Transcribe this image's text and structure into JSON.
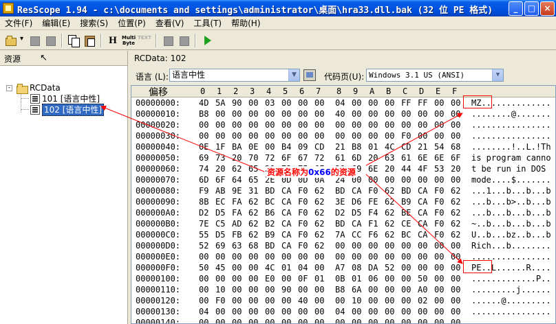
{
  "window": {
    "title": "ResScope 1.94 - c:\\documents and settings\\administrator\\桌面\\hra33.dll.bak (32 位 PE 格式)",
    "buttons": {
      "minimize": "_",
      "maximize": "□",
      "close": "×"
    }
  },
  "menu": [
    "文件(F)",
    "编辑(E)",
    "搜索(S)",
    "位置(P)",
    "查看(V)",
    "工具(T)",
    "帮助(H)"
  ],
  "toolbar": {
    "h_label": "H",
    "multibyte_label": "Multi Byte",
    "text_label": "TEXT"
  },
  "left_pane": {
    "header": "资源",
    "tree": {
      "root": "RCData",
      "expander": "-",
      "items": [
        "101 [语言中性]",
        "102 [语言中性]"
      ],
      "selected_index": 1
    }
  },
  "right_pane": {
    "rcdata_label": "RCData: 102",
    "language_label": "语言 (L):",
    "language_value": "语言中性",
    "codepage_label": "代码页(U):",
    "codepage_value": "Windows 3.1 US (ANSI)"
  },
  "hex_view": {
    "offset_header": "偏移",
    "columns": [
      "0",
      "1",
      "2",
      "3",
      "4",
      "5",
      "6",
      "7",
      "8",
      "9",
      "A",
      "B",
      "C",
      "D",
      "E",
      "F"
    ],
    "rows": [
      {
        "offset": "00000000:",
        "bytes": [
          "4D",
          "5A",
          "90",
          "00",
          "03",
          "00",
          "00",
          "00",
          "04",
          "00",
          "00",
          "00",
          "FF",
          "FF",
          "00",
          "00"
        ],
        "ascii": "MZ.............."
      },
      {
        "offset": "00000010:",
        "bytes": [
          "B8",
          "00",
          "00",
          "00",
          "00",
          "00",
          "00",
          "00",
          "40",
          "00",
          "00",
          "00",
          "00",
          "00",
          "00",
          "00"
        ],
        "ascii": "........@......."
      },
      {
        "offset": "00000020:",
        "bytes": [
          "00",
          "00",
          "00",
          "00",
          "00",
          "00",
          "00",
          "00",
          "00",
          "00",
          "00",
          "00",
          "00",
          "00",
          "00",
          "00"
        ],
        "ascii": "................"
      },
      {
        "offset": "00000030:",
        "bytes": [
          "00",
          "00",
          "00",
          "00",
          "00",
          "00",
          "00",
          "00",
          "00",
          "00",
          "00",
          "00",
          "F0",
          "00",
          "00",
          "00"
        ],
        "ascii": "................"
      },
      {
        "offset": "00000040:",
        "bytes": [
          "0E",
          "1F",
          "BA",
          "0E",
          "00",
          "B4",
          "09",
          "CD",
          "21",
          "B8",
          "01",
          "4C",
          "CD",
          "21",
          "54",
          "68"
        ],
        "ascii": "........!..L.!Th"
      },
      {
        "offset": "00000050:",
        "bytes": [
          "69",
          "73",
          "20",
          "70",
          "72",
          "6F",
          "67",
          "72",
          "61",
          "6D",
          "20",
          "63",
          "61",
          "6E",
          "6E",
          "6F"
        ],
        "ascii": "is program canno"
      },
      {
        "offset": "00000060:",
        "bytes": [
          "74",
          "20",
          "62",
          "65",
          "20",
          "72",
          "75",
          "6E",
          "20",
          "69",
          "6E",
          "20",
          "44",
          "4F",
          "53",
          "20"
        ],
        "ascii": "t be run in DOS "
      },
      {
        "offset": "00000070:",
        "bytes": [
          "6D",
          "6F",
          "64",
          "65",
          "2E",
          "0D",
          "0D",
          "0A",
          "24",
          "00",
          "00",
          "00",
          "00",
          "00",
          "00",
          "00"
        ],
        "ascii": "mode....$......."
      },
      {
        "offset": "00000080:",
        "bytes": [
          "F9",
          "AB",
          "9E",
          "31",
          "BD",
          "CA",
          "F0",
          "62",
          "BD",
          "CA",
          "F0",
          "62",
          "BD",
          "CA",
          "F0",
          "62"
        ],
        "ascii": "...1...b...b...b"
      },
      {
        "offset": "00000090:",
        "bytes": [
          "8B",
          "EC",
          "FA",
          "62",
          "BC",
          "CA",
          "F0",
          "62",
          "3E",
          "D6",
          "FE",
          "62",
          "B9",
          "CA",
          "F0",
          "62"
        ],
        "ascii": "...b...b>..b...b"
      },
      {
        "offset": "000000A0:",
        "bytes": [
          "D2",
          "D5",
          "FA",
          "62",
          "B6",
          "CA",
          "F0",
          "62",
          "D2",
          "D5",
          "F4",
          "62",
          "BE",
          "CA",
          "F0",
          "62"
        ],
        "ascii": "...b...b...b...b"
      },
      {
        "offset": "000000B0:",
        "bytes": [
          "7E",
          "C5",
          "AD",
          "62",
          "B2",
          "CA",
          "F0",
          "62",
          "BD",
          "CA",
          "F1",
          "62",
          "CE",
          "CA",
          "F0",
          "62"
        ],
        "ascii": "~..b...b...b...b"
      },
      {
        "offset": "000000C0:",
        "bytes": [
          "55",
          "D5",
          "FB",
          "62",
          "B9",
          "CA",
          "F0",
          "62",
          "7A",
          "CC",
          "F6",
          "62",
          "BC",
          "CA",
          "F0",
          "62"
        ],
        "ascii": "U..b...bz..b...b"
      },
      {
        "offset": "000000D0:",
        "bytes": [
          "52",
          "69",
          "63",
          "68",
          "BD",
          "CA",
          "F0",
          "62",
          "00",
          "00",
          "00",
          "00",
          "00",
          "00",
          "00",
          "00"
        ],
        "ascii": "Rich...b........"
      },
      {
        "offset": "000000E0:",
        "bytes": [
          "00",
          "00",
          "00",
          "00",
          "00",
          "00",
          "00",
          "00",
          "00",
          "00",
          "00",
          "00",
          "00",
          "00",
          "00",
          "00"
        ],
        "ascii": "................"
      },
      {
        "offset": "000000F0:",
        "bytes": [
          "50",
          "45",
          "00",
          "00",
          "4C",
          "01",
          "04",
          "00",
          "A7",
          "08",
          "DA",
          "52",
          "00",
          "00",
          "00",
          "00"
        ],
        "ascii": "PE..L......R...."
      },
      {
        "offset": "00000100:",
        "bytes": [
          "00",
          "00",
          "00",
          "00",
          "E0",
          "00",
          "0F",
          "01",
          "0B",
          "01",
          "06",
          "00",
          "00",
          "50",
          "00",
          "00"
        ],
        "ascii": ".............P.."
      },
      {
        "offset": "00000110:",
        "bytes": [
          "00",
          "10",
          "00",
          "00",
          "00",
          "90",
          "00",
          "00",
          "B8",
          "6A",
          "00",
          "00",
          "00",
          "A0",
          "00",
          "00"
        ],
        "ascii": ".........j......"
      },
      {
        "offset": "00000120:",
        "bytes": [
          "00",
          "F0",
          "00",
          "00",
          "00",
          "00",
          "40",
          "00",
          "00",
          "10",
          "00",
          "00",
          "00",
          "02",
          "00",
          "00"
        ],
        "ascii": "......@........."
      },
      {
        "offset": "00000130:",
        "bytes": [
          "04",
          "00",
          "00",
          "00",
          "00",
          "00",
          "00",
          "00",
          "04",
          "00",
          "00",
          "00",
          "00",
          "00",
          "00",
          "00"
        ],
        "ascii": "................"
      },
      {
        "offset": "00000140:",
        "bytes": [
          "00",
          "00",
          "00",
          "00",
          "00",
          "00",
          "00",
          "00",
          "00",
          "00",
          "00",
          "00",
          "00",
          "00",
          "00",
          "00"
        ],
        "ascii": "................"
      }
    ]
  },
  "annotation": {
    "prefix": "资源名称为",
    "highlight": "0x66",
    "suffix": "的资源",
    "color": "#ff0000",
    "highlight_color": "#0000ff"
  }
}
